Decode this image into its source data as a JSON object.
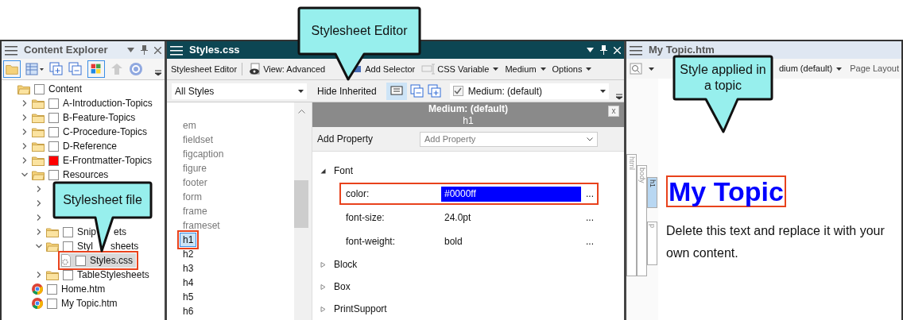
{
  "callouts": [
    {
      "text": "Stylesheet Editor"
    },
    {
      "text": "Stylesheet file"
    },
    {
      "text": "Style applied in a topic"
    }
  ],
  "content_explorer": {
    "title": "Content Explorer",
    "tree": [
      {
        "label": "Content",
        "kind": "open-folder",
        "annotated": false,
        "selected": false,
        "children": [
          {
            "label": "A-Introduction-Topics",
            "kind": "folder",
            "expanded": false,
            "annotated": false,
            "selected": false
          },
          {
            "label": "B-Feature-Topics",
            "kind": "folder",
            "expanded": false,
            "annotated": false,
            "selected": false
          },
          {
            "label": "C-Procedure-Topics",
            "kind": "folder",
            "expanded": false,
            "annotated": false,
            "selected": false
          },
          {
            "label": "D-Reference",
            "kind": "folder",
            "expanded": false,
            "annotated": false,
            "selected": false
          },
          {
            "label": "E-Frontmatter-Topics",
            "kind": "folder",
            "expanded": false,
            "annotated": false,
            "selected": false,
            "color": "#ff0000"
          },
          {
            "label": "Resources",
            "kind": "open-folder",
            "expanded": true,
            "annotated": false,
            "selected": false,
            "children": [
              {
                "expanded": false
              },
              {
                "expanded": false
              },
              {
                "expanded": false
              },
              {
                "label": "Snip",
                "label_end": "ets",
                "kind": "folder",
                "expanded": false,
                "annotated": false,
                "selected": false
              },
              {
                "label": "Styl",
                "label_end": "sheets",
                "kind": "open-folder",
                "expanded": true,
                "annotated": false,
                "selected": false,
                "children": [
                  {
                    "label": "Styles.css",
                    "kind": "stylesheet",
                    "annotated": true,
                    "selected": true
                  }
                ]
              },
              {
                "label": "TableStylesheets",
                "kind": "folder",
                "expanded": false,
                "annotated": false,
                "selected": false
              }
            ]
          },
          {
            "label": "Home.htm",
            "kind": "browser",
            "annotated": false,
            "selected": false
          },
          {
            "label": "My Topic.htm",
            "kind": "browser",
            "annotated": false,
            "selected": false
          }
        ]
      }
    ]
  },
  "stylesheet_editor": {
    "title": "Styles.css",
    "toolbar": [
      {
        "label": "Stylesheet Editor",
        "kind": "plain",
        "dropdown": false
      },
      {
        "label": "View: Advanced",
        "kind": "eye",
        "dropdown": false
      },
      {
        "label": "Add Selector",
        "kind": "selector",
        "dropdown": false
      },
      {
        "label": "CSS Variable",
        "kind": "variable",
        "dropdown": true
      },
      {
        "label": "Medium",
        "kind": "plain",
        "dropdown": true
      },
      {
        "label": "Options",
        "kind": "plain",
        "dropdown": true
      }
    ],
    "filter": {
      "value": "All Styles"
    },
    "hide_inherited": {
      "label": "Hide Inherited"
    },
    "medium": {
      "checked": true,
      "value": "Medium: (default)"
    },
    "styles": [
      {
        "label": "em",
        "defined": false,
        "selected": false
      },
      {
        "label": "fieldset",
        "defined": false,
        "selected": false
      },
      {
        "label": "figcaption",
        "defined": false,
        "selected": false
      },
      {
        "label": "figure",
        "defined": false,
        "selected": false
      },
      {
        "label": "footer",
        "defined": false,
        "selected": false
      },
      {
        "label": "form",
        "defined": false,
        "selected": false
      },
      {
        "label": "frame",
        "defined": false,
        "selected": false
      },
      {
        "label": "frameset",
        "defined": false,
        "selected": false
      },
      {
        "label": "h1",
        "defined": true,
        "selected": true
      },
      {
        "label": "h2",
        "defined": true,
        "selected": false
      },
      {
        "label": "h3",
        "defined": true,
        "selected": false
      },
      {
        "label": "h4",
        "defined": true,
        "selected": false
      },
      {
        "label": "h5",
        "defined": true,
        "selected": false
      },
      {
        "label": "h6",
        "defined": true,
        "selected": false
      }
    ],
    "properties_panel": {
      "medium": "Medium: (default)",
      "selector": "h1",
      "close": "x",
      "add_property_label": "Add Property",
      "add_property_placeholder": "Add Property",
      "groups": [
        {
          "label": "Font",
          "expanded": true,
          "properties": [
            {
              "name": "color:",
              "value": "#0000ff",
              "selected": true,
              "annotated": true,
              "more": "..."
            },
            {
              "name": "font-size:",
              "value": "24.0pt",
              "selected": false,
              "annotated": false,
              "more": "..."
            },
            {
              "name": "font-weight:",
              "value": "bold",
              "selected": false,
              "annotated": false,
              "more": "..."
            }
          ]
        },
        {
          "label": "Block",
          "expanded": false
        },
        {
          "label": "Box",
          "expanded": false
        },
        {
          "label": "PrintSupport",
          "expanded": false
        }
      ]
    }
  },
  "topic_editor": {
    "title": "My Topic.htm",
    "toolbar": [
      {
        "label": "dium (default)",
        "dropdown": true
      },
      {
        "label": "Page Layout",
        "dropdown": false
      }
    ],
    "structure_bars": [
      {
        "label": "html",
        "selected": false
      },
      {
        "label": "body",
        "selected": false
      },
      {
        "label": "h1",
        "selected": true
      },
      {
        "label": "p",
        "selected": false
      }
    ],
    "heading": {
      "text": "My Topic",
      "annotated": true
    },
    "paragraph": "Delete this text and replace it with your own content."
  }
}
